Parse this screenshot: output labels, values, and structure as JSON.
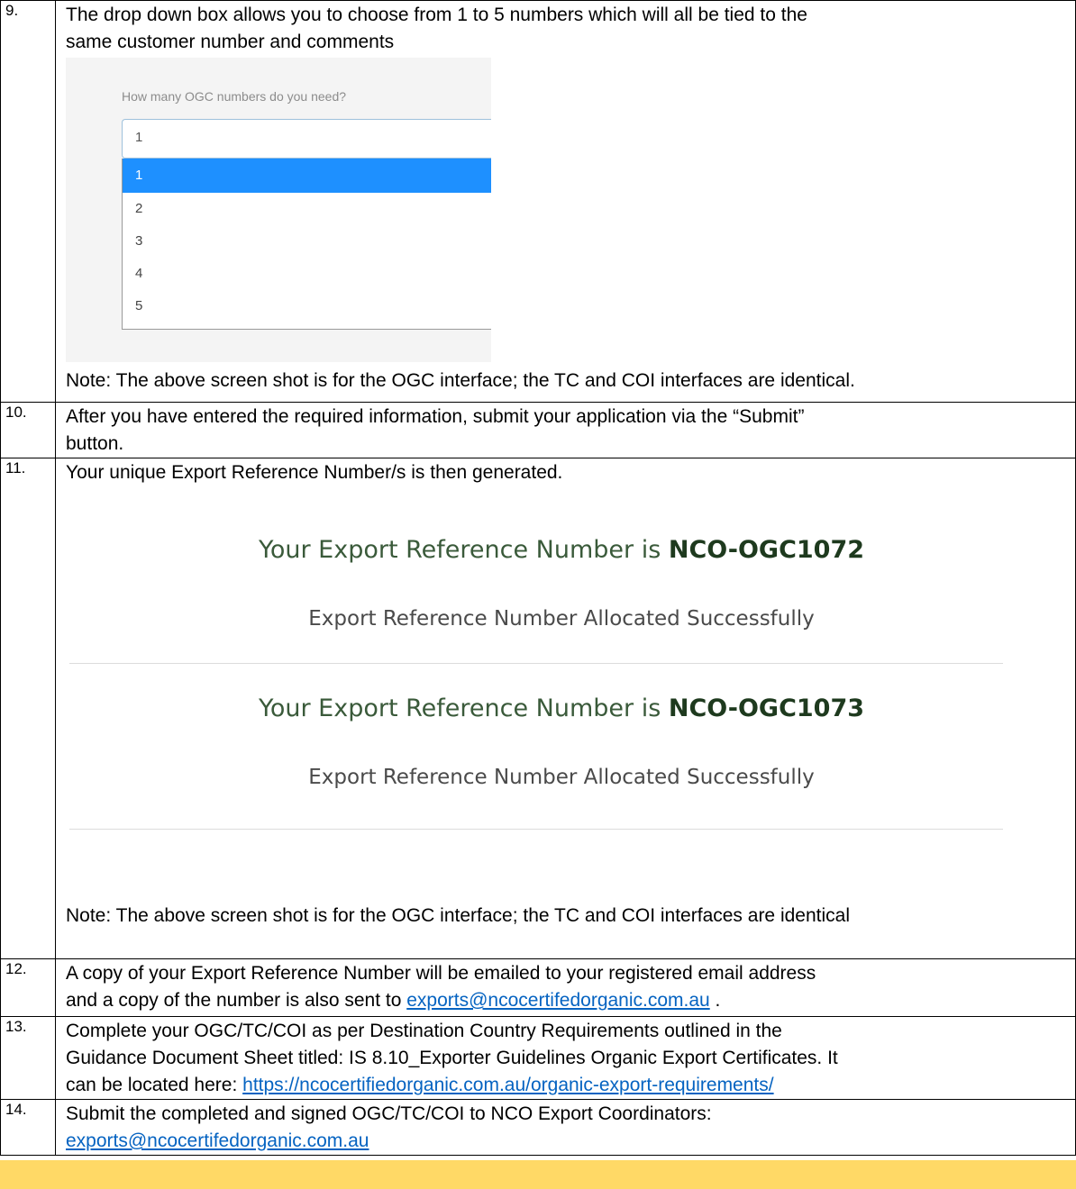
{
  "steps": [
    {
      "number": "9.",
      "lines": [
        "The drop down box allows you to choose from 1 to 5 numbers which will all be tied to the",
        "same customer number and comments"
      ],
      "dropdown": {
        "question": "How many OGC numbers do you need?",
        "selected": "1",
        "options": [
          "1",
          "2",
          "3",
          "4",
          "5"
        ]
      },
      "note": "Note: The above screen shot is for the OGC interface; the TC and COI interfaces are identical."
    },
    {
      "number": "10.",
      "lines": [
        "After you have entered the required information, submit your application via the “Submit”",
        "button."
      ]
    },
    {
      "number": "11.",
      "lines": [
        "Your unique Export Reference Number/s is then generated."
      ],
      "allocations": [
        {
          "prefix": "Your Export Reference Number is",
          "number": "NCO-OGC1072",
          "status": "Export Reference Number Allocated Successfully"
        },
        {
          "prefix": "Your Export Reference Number is",
          "number": "NCO-OGC1073",
          "status": "Export Reference Number Allocated Successfully"
        }
      ],
      "note": "Note: The above screen shot is for the OGC interface; the TC and COI interfaces are identical"
    },
    {
      "number": "12.",
      "line1": "A copy of your Export Reference Number will be emailed to your registered email address",
      "line2_before": "and a copy of the number is also sent to ",
      "link": "exports@ncocertifedorganic.com.au",
      "line2_after": " ."
    },
    {
      "number": "13.",
      "line1": "Complete your OGC/TC/COI as per Destination Country Requirements outlined in the",
      "line2": "Guidance Document Sheet titled: IS 8.10_Exporter Guidelines Organic Export Certificates. It",
      "line3_before": "can be located here: ",
      "link": "https://ncocertifiedorganic.com.au/organic-export-requirements/"
    },
    {
      "number": "14.",
      "line1": "Submit the completed and signed OGC/TC/COI to NCO Export Coordinators:",
      "link": "exports@ncocertifedorganic.com.au"
    }
  ]
}
